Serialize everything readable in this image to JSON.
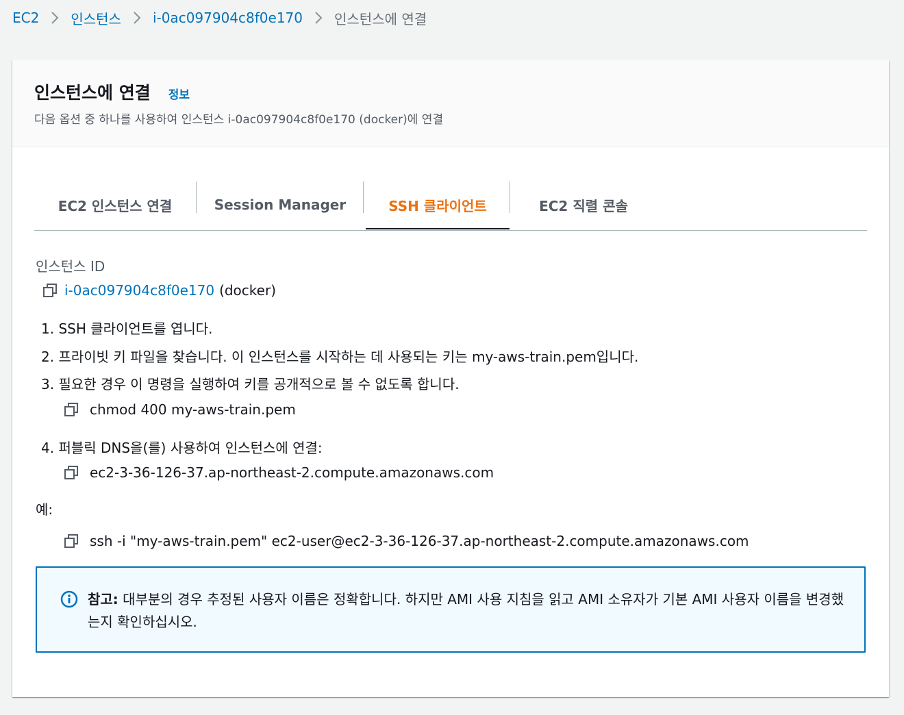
{
  "breadcrumb": {
    "items": [
      "EC2",
      "인스턴스",
      "i-0ac097904c8f0e170"
    ],
    "current": "인스턴스에 연결"
  },
  "header": {
    "title": "인스턴스에 연결",
    "info_link": "정보",
    "description": "다음 옵션 중 하나를 사용하여 인스턴스 i-0ac097904c8f0e170 (docker)에 연결"
  },
  "tabs": [
    {
      "label": "EC2 인스턴스 연결",
      "active": false
    },
    {
      "label": "Session Manager",
      "active": false
    },
    {
      "label": "SSH 클라이언트",
      "active": true
    },
    {
      "label": "EC2 직렬 콘솔",
      "active": false
    }
  ],
  "instance": {
    "label": "인스턴스 ID",
    "id": "i-0ac097904c8f0e170",
    "name_suffix": "(docker)"
  },
  "steps": [
    "1. SSH 클라이언트를 엽니다.",
    "2. 프라이빗 키 파일을 찾습니다. 이 인스턴스를 시작하는 데 사용되는 키는 my-aws-train.pem입니다.",
    "3. 필요한 경우 이 명령을 실행하여 키를 공개적으로 볼 수 없도록 합니다.",
    "4. 퍼블릭 DNS을(를) 사용하여 인스턴스에 연결:"
  ],
  "commands": {
    "chmod": "chmod 400 my-aws-train.pem",
    "dns": "ec2-3-36-126-37.ap-northeast-2.compute.amazonaws.com",
    "example_label": "예:",
    "ssh": "ssh -i \"my-aws-train.pem\" ec2-user@ec2-3-36-126-37.ap-northeast-2.compute.amazonaws.com"
  },
  "note": {
    "label": "참고:",
    "text": " 대부분의 경우 추정된 사용자 이름은 정확합니다. 하지만 AMI 사용 지침을 읽고 AMI 소유자가 기본 AMI 사용자 이름을 변경했는지 확인하십시오."
  },
  "colors": {
    "link": "#0073bb",
    "active_tab": "#ec7211",
    "info_bg": "#f1faff",
    "info_border": "#0073bb"
  },
  "icons": [
    "chevron-right-icon",
    "copy-icon",
    "info-icon"
  ]
}
